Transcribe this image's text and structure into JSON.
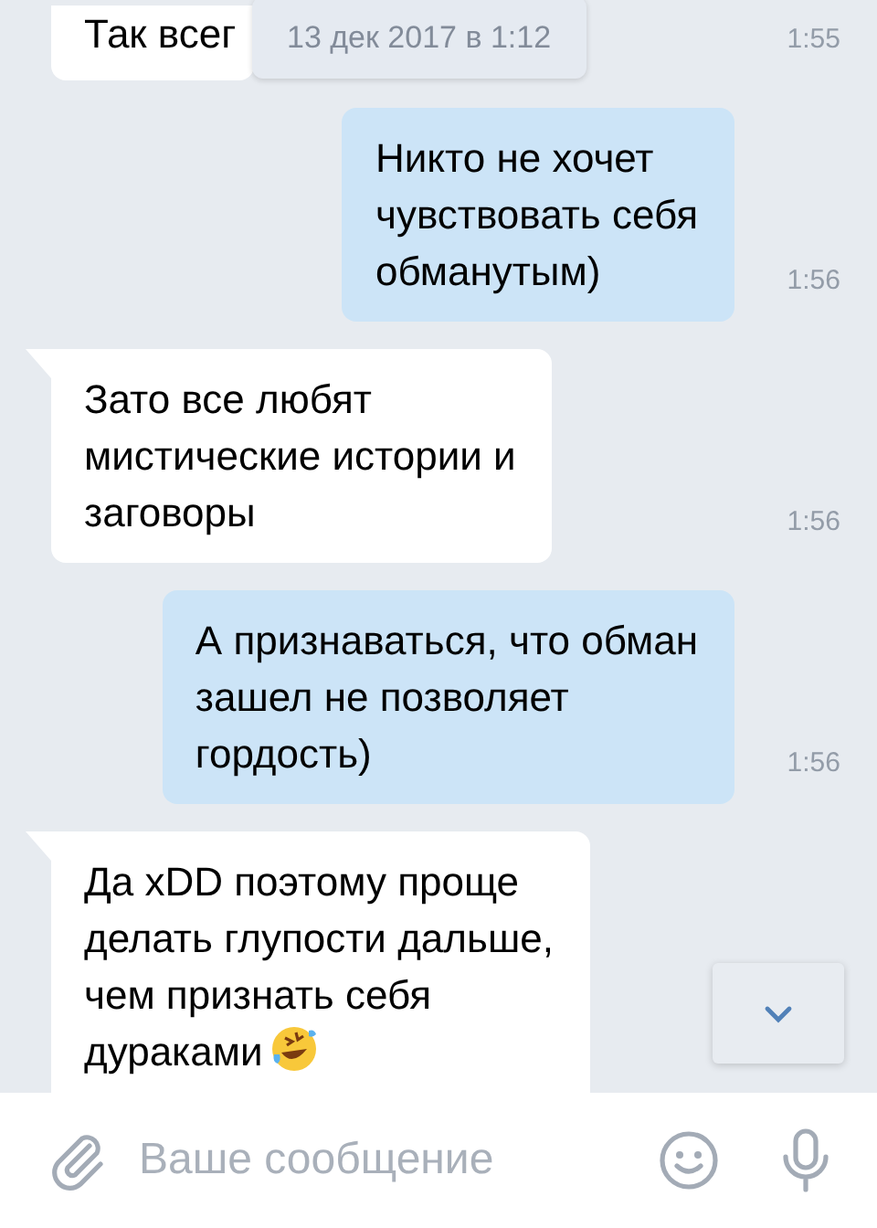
{
  "date_pill": "13 дек 2017 в 1:12",
  "messages": [
    {
      "kind": "incoming",
      "text": "Так всег",
      "time": "1:55",
      "cut_top": true
    },
    {
      "kind": "outgoing",
      "text": "Никто не хочет\nчувствовать себя\nобманутым)",
      "time": "1:56"
    },
    {
      "kind": "incoming",
      "text": "Зато все любят\nмистические истории и\nзаговоры",
      "time": "1:56"
    },
    {
      "kind": "outgoing",
      "text": "А признаваться, что обман\nзашел не позволяет\nгордость)",
      "time": "1:56"
    },
    {
      "kind": "incoming",
      "text": "Да xDD поэтому проще\nделать глупости дальше,\nчем признать себя\nдураками",
      "trailing_emoji": true
    }
  ],
  "composer": {
    "placeholder": "Ваше сообщение"
  }
}
